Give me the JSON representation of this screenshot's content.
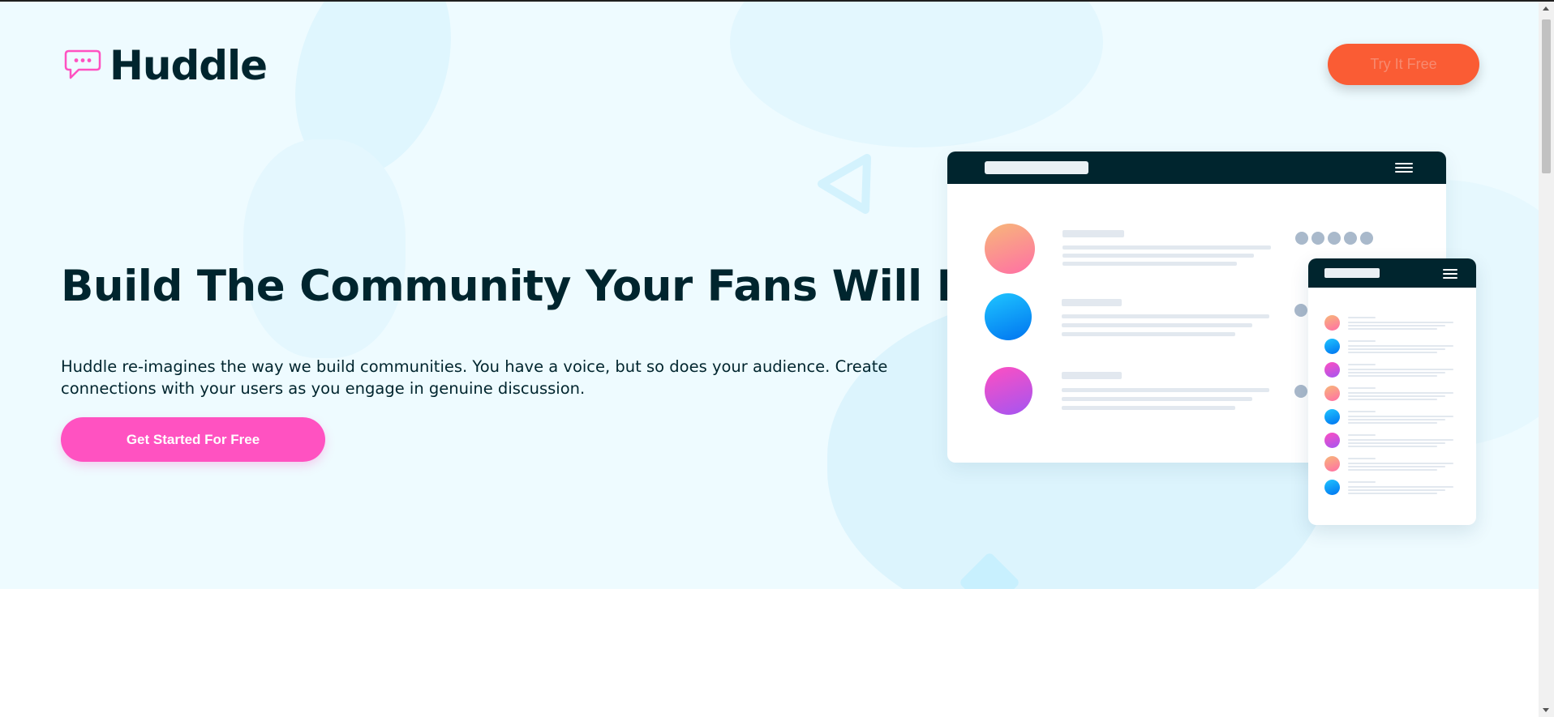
{
  "header": {
    "logo_text": "Huddle",
    "logo_icon": "chat-bubble-icon",
    "try_label": "Try It Free"
  },
  "hero": {
    "headline": "Build The Community Your Fans Will Love",
    "description": "Huddle re-imagines the way we build communities. You have a voice, but so does your audience. Create connections with your users as you engage in genuine discussion.",
    "cta_label": "Get Started For Free"
  },
  "colors": {
    "brand_dark": "#00252e",
    "accent_orange": "#fa5c34",
    "accent_pink": "#ff52c1",
    "hero_background": "#eefbff"
  },
  "icons": [
    "chat-bubble-icon",
    "menu-icon",
    "triangle-outline-shape",
    "diamond-shape"
  ]
}
